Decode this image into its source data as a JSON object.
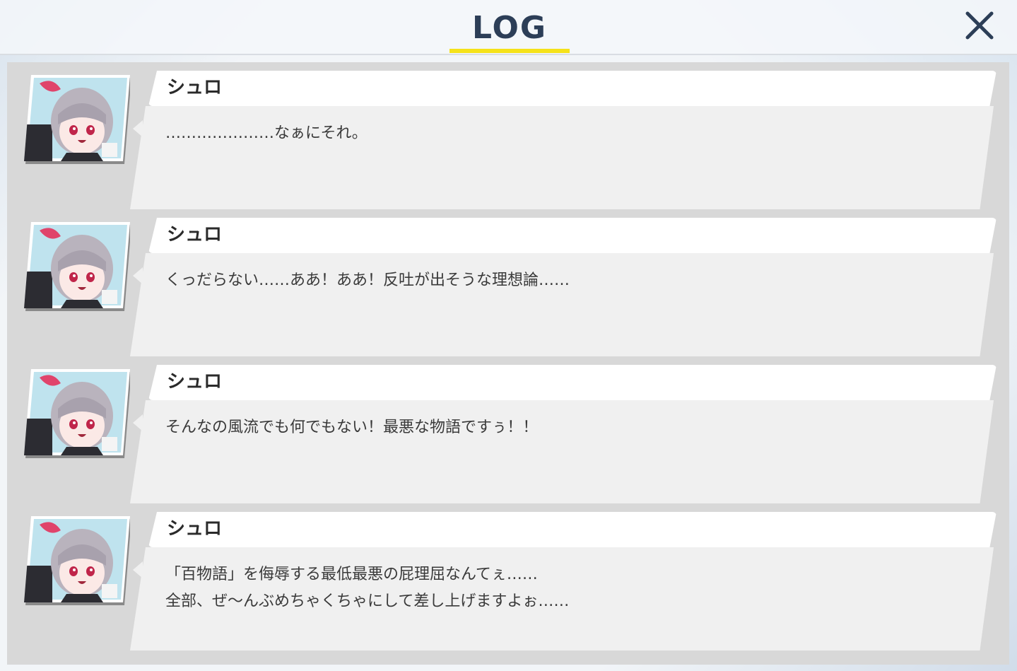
{
  "header": {
    "title": "LOG",
    "accent_color": "#f5e21a",
    "close_icon": "close-icon"
  },
  "entries": [
    {
      "speaker": "シュロ",
      "avatar_icon": "character-portrait",
      "text": "…………………なぁにそれ。"
    },
    {
      "speaker": "シュロ",
      "avatar_icon": "character-portrait",
      "text": "くっだらない……ああ！ああ！反吐が出そうな理想論……"
    },
    {
      "speaker": "シュロ",
      "avatar_icon": "character-portrait",
      "text": "そんなの風流でも何でもない！最悪な物語ですぅ！！"
    },
    {
      "speaker": "シュロ",
      "avatar_icon": "character-portrait",
      "text": "「百物語」を侮辱する最低最悪の屁理屈なんてぇ……\n全部、ぜ〜んぶめちゃくちゃにして差し上げますよぉ……"
    }
  ]
}
